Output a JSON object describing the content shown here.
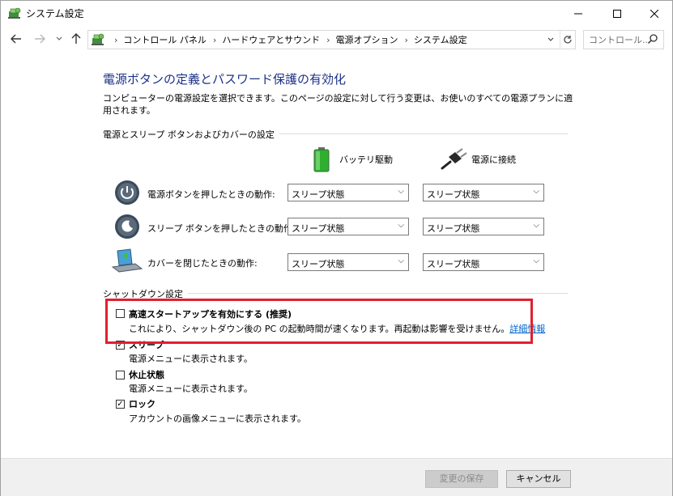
{
  "window": {
    "title": "システム設定"
  },
  "breadcrumb": [
    "コントロール パネル",
    "ハードウェアとサウンド",
    "電源オプション",
    "システム設定"
  ],
  "search": {
    "placeholder": "コントロール..."
  },
  "page": {
    "title": "電源ボタンの定義とパスワード保護の有効化",
    "description": "コンピューターの電源設定を選択できます。このページの設定に対して行う変更は、お使いのすべての電源プランに適用されます。"
  },
  "power_section": {
    "label": "電源とスリープ ボタンおよびカバーの設定",
    "column_battery": "バッテリ駆動",
    "column_plugged": "電源に接続",
    "rows": [
      {
        "label": "電源ボタンを押したときの動作:",
        "battery": "スリープ状態",
        "plugged": "スリープ状態",
        "icon": "power-button-icon"
      },
      {
        "label": "スリープ ボタンを押したときの動作:",
        "battery": "スリープ状態",
        "plugged": "スリープ状態",
        "icon": "sleep-button-icon"
      },
      {
        "label": "カバーを閉じたときの動作:",
        "battery": "スリープ状態",
        "plugged": "スリープ状態",
        "icon": "laptop-lid-icon"
      }
    ]
  },
  "shutdown_section": {
    "label": "シャットダウン設定",
    "options": [
      {
        "title": "高速スタートアップを有効にする (推奨)",
        "description": "これにより、シャットダウン後の PC の起動時間が速くなります。再起動は影響を受けません。",
        "link": "詳細情報",
        "checked": false
      },
      {
        "title": "スリープ",
        "description": "電源メニューに表示されます。",
        "checked": true
      },
      {
        "title": "休止状態",
        "description": "電源メニューに表示されます。",
        "checked": false
      },
      {
        "title": "ロック",
        "description": "アカウントの画像メニューに表示されます。",
        "checked": true
      }
    ]
  },
  "footer": {
    "save_label": "変更の保存",
    "cancel_label": "キャンセル"
  },
  "colors": {
    "title_blue": "#1e3287",
    "highlight_red": "#e0202e",
    "link_blue": "#0066cc"
  }
}
